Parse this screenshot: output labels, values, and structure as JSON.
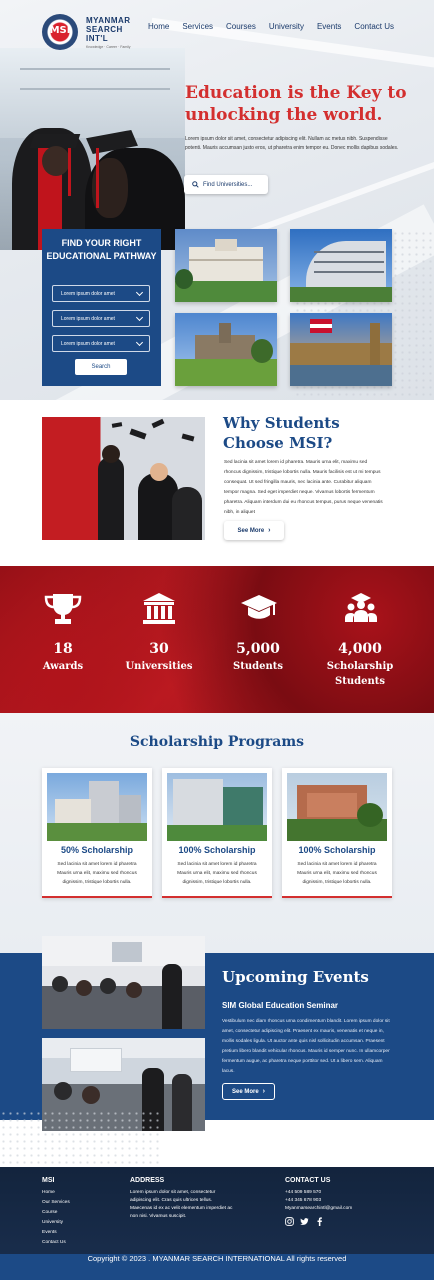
{
  "logo": {
    "line1": "MYANMAR",
    "line2": "SEARCH",
    "line3": "INT'L",
    "tagline": "Knowledge · Career · Family",
    "badge": "MSI"
  },
  "nav": [
    "Home",
    "Services",
    "Courses",
    "University",
    "Events",
    "Contact Us"
  ],
  "hero": {
    "title": "Education is the Key to unlocking the world.",
    "text": "Lorem ipsum dolor sit amet, consectetur adipiscing elit. Nullam ac metus nibh. Suspendisse potenti. Mauris accumsan justo eros, ut pharetra enim tempor eu. Donec mollis dapibus sodales.",
    "search_label": "Find Universities..."
  },
  "pathway": {
    "title": "FIND YOUR RIGHT EDUCATIONAL PATHWAY",
    "selects": [
      "Lorem ipsum dolor amet",
      "Lorem ipsum dolor amet",
      "Lorem ipsum dolor amet"
    ],
    "button": "Search"
  },
  "why": {
    "title": "Why Students Choose MSI?",
    "text": "Sed lacinia sit amet lorem id pharetra. Mauris urna elit, maximu sed rhoncus dignissim, tristique lobortis nulla. Mauris facilisis est ut mi tempus consequat. Ut sed fringilla mauris, nec lacinia ante. Curabitur aliquam tempor magna. Sed eget imperdiet neque. Vivamus lobortis fermentum pharetra. Aliquam interdum dui eu rhoncus tempus, purus neque venenatis nibh, in aliquet",
    "button": "See More"
  },
  "stats": [
    {
      "icon": "trophy-icon",
      "number": "18",
      "label": "Awards"
    },
    {
      "icon": "university-icon",
      "number": "30",
      "label": "Universities"
    },
    {
      "icon": "graduation-cap-icon",
      "number": "5,000",
      "label": "Students"
    },
    {
      "icon": "scholarship-students-icon",
      "number": "4,000",
      "label": "Scholarship Students"
    }
  ],
  "scholarships": {
    "title": "Scholarship Programs",
    "cards": [
      {
        "heading": "50% Scholarship",
        "text": "Sed lacinia sit amet lorem id pharetra Mauris urna elit, maximu sed rhoncus dignissim, tristique lobortis nulla."
      },
      {
        "heading": "100% Scholarship",
        "text": "Sed lacinia sit amet lorem id pharetra Mauris urna elit, maximu sed rhoncus dignissim, tristique lobortis nulla."
      },
      {
        "heading": "100% Scholarship",
        "text": "Sed lacinia sit amet lorem id pharetra Mauris urna elit, maximu sed rhoncus dignissim, tristique lobortis nulla."
      }
    ]
  },
  "events": {
    "title": "Upcoming Events",
    "subtitle": "SIM Global Education Seminar",
    "text": "Vestibulum nec diam rhoncus urna condimentum blandit. Lorem ipsum dolor sit amet, consectetur adipiscing elit. Praesent ex mauris, venenatis et neque in, mollis sodales ligula. Ut auctor ante quis nisl sollicitudin accumsan. Praesent pretium libero blandit vehicular rhoncus. Mauris id semper nunc. In ullamcorper fermentum augue, ac pharetra neque porttitor sed. Ut a libero sem. Aliquam lacus.",
    "button": "See More"
  },
  "footer": {
    "msi_heading": "MSI",
    "links": [
      "Home",
      "Our Services",
      "Course",
      "University",
      "Events",
      "Contact Us"
    ],
    "address_heading": "ADDRESS",
    "address_text": "Lorem ipsum dolor sit amet, consectetur adipiscing elit. Cras quis ultrices tellus. Maecenas id ex ac velit elementum imperdiet ac non nisi. Vivamus suscipit.",
    "contact_heading": "CONTACT US",
    "phone1": "+44 509 589 570",
    "phone2": "+44 345 678 903",
    "email": "Myanmarsearchintl@gmail.com",
    "copyright": "Copyright © 2023 .  MYANMAR SEARCH INTERNATIONAL All rights reserved"
  },
  "colors": {
    "brand_red": "#d32f2f",
    "brand_blue": "#1c4a86",
    "footer_dark": "#13243d"
  }
}
